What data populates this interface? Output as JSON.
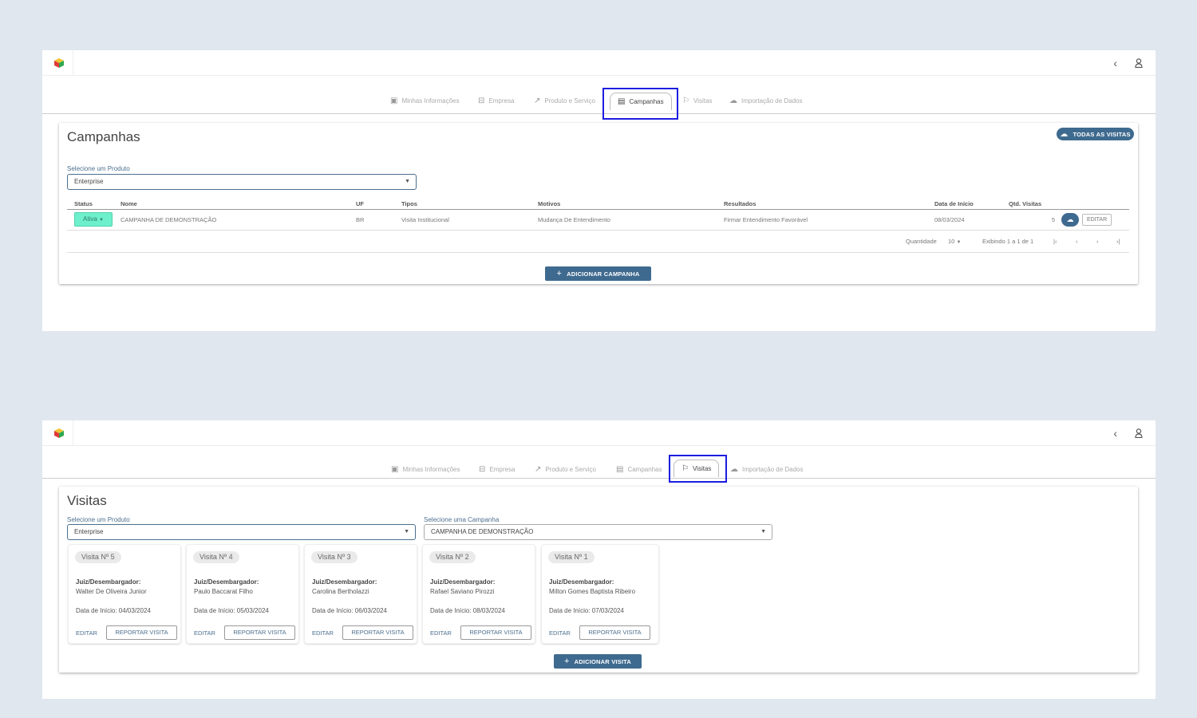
{
  "icons": {
    "logo": "cube-logo-icon",
    "collapse": "chevron-left-icon",
    "user": "user-icon"
  },
  "colors": {
    "accent": "#3f6a8f",
    "status_active": "#6ff0cc",
    "highlight": "#1c1ce0"
  },
  "tabs": [
    {
      "label": "Minhas Informações",
      "icon": "id-card-icon"
    },
    {
      "label": "Empresa",
      "icon": "briefcase-icon"
    },
    {
      "label": "Produto e Serviço",
      "icon": "trend-icon"
    },
    {
      "label": "Campanhas",
      "icon": "clipboard-icon"
    },
    {
      "label": "Visitas",
      "icon": "flag-icon"
    },
    {
      "label": "Importação de Dados",
      "icon": "cloud-upload-icon"
    }
  ],
  "campanhas": {
    "title": "Campanhas",
    "all_visits_button": "TODAS AS VISITAS",
    "product_label": "Selecione um Produto",
    "product_value": "Enterprise",
    "columns": [
      "Status",
      "Nome",
      "UF",
      "Tipos",
      "Motivos",
      "Resultados",
      "Data de Início",
      "Qtd. Visitas"
    ],
    "rows": [
      {
        "status": "Ativa",
        "nome": "CAMPANHA DE DEMONSTRAÇÃO",
        "uf": "BR",
        "tipos": "Visita Institucional",
        "motivos": "Mudança De Entendimento",
        "resultados": "Firmar Entendimento Favorável",
        "data": "08/03/2024",
        "qtd": "5",
        "edit": "EDITAR"
      }
    ],
    "pager": {
      "quantity_label": "Quantidade",
      "quantity": "10",
      "range": "Exibindo 1 a 1 de 1"
    },
    "add_button": "ADICIONAR CAMPANHA"
  },
  "visitas": {
    "title": "Visitas",
    "product_label": "Selecione um Produto",
    "product_value": "Enterprise",
    "campaign_label": "Selecione uma Campanha",
    "campaign_value": "CAMPANHA DE DEMONSTRAÇÃO",
    "role_label": "Juiz/Desembargador:",
    "edit_label": "EDITAR",
    "report_label": "REPORTAR VISITA",
    "cards": [
      {
        "title": "Visita Nº 5",
        "name": "Walter De Oliveira Junior",
        "date": "Data de Início: 04/03/2024"
      },
      {
        "title": "Visita Nº 4",
        "name": "Paulo Baccarat Filho",
        "date": "Data de Início: 05/03/2024"
      },
      {
        "title": "Visita Nº 3",
        "name": "Carolina Bertholazzi",
        "date": "Data de Início: 06/03/2024"
      },
      {
        "title": "Visita Nº 2",
        "name": "Rafael Saviano Pirozzi",
        "date": "Data de Início: 08/03/2024"
      },
      {
        "title": "Visita Nº 1",
        "name": "Milton Gomes Baptista Ribeiro",
        "date": "Data de Início: 07/03/2024"
      }
    ],
    "add_button": "ADICIONAR VISITA"
  }
}
